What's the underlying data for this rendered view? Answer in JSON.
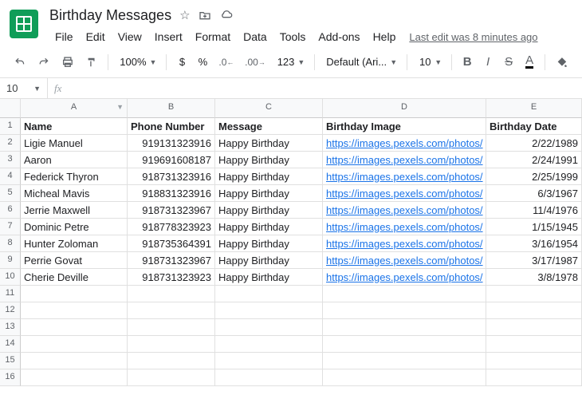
{
  "doc": {
    "title": "Birthday Messages",
    "last_edit": "Last edit was 8 minutes ago"
  },
  "menus": [
    "File",
    "Edit",
    "View",
    "Insert",
    "Format",
    "Data",
    "Tools",
    "Add-ons",
    "Help"
  ],
  "toolbar": {
    "zoom": "100%",
    "currency": "$",
    "percent": "%",
    "dec_dec": ".0",
    "dec_inc": ".00",
    "more_fmt": "123",
    "font": "Default (Ari...",
    "font_size": "10",
    "bold": "B",
    "italic": "I",
    "strike": "S",
    "textcolor": "A"
  },
  "namebox": "10",
  "fx_label": "fx",
  "columns": [
    "A",
    "B",
    "C",
    "D",
    "E"
  ],
  "headers": [
    "Name",
    "Phone Number",
    "Message",
    "Birthday Image",
    "Birthday Date"
  ],
  "rows": [
    {
      "name": "Ligie Manuel",
      "phone": "919131323916",
      "msg": "Happy Birthday",
      "img": "https://images.pexels.com/photos/",
      "date": "2/22/1989"
    },
    {
      "name": "Aaron",
      "phone": "919691608187",
      "msg": "Happy Birthday",
      "img": "https://images.pexels.com/photos/",
      "date": "2/24/1991"
    },
    {
      "name": "Federick Thyron",
      "phone": "918731323916",
      "msg": "Happy Birthday",
      "img": "https://images.pexels.com/photos/",
      "date": "2/25/1999"
    },
    {
      "name": "Micheal Mavis",
      "phone": "918831323916",
      "msg": "Happy Birthday",
      "img": "https://images.pexels.com/photos/",
      "date": "6/3/1967"
    },
    {
      "name": "Jerrie Maxwell",
      "phone": "918731323967",
      "msg": "Happy Birthday",
      "img": "https://images.pexels.com/photos/",
      "date": "11/4/1976"
    },
    {
      "name": "Dominic Petre",
      "phone": "918778323923",
      "msg": "Happy Birthday",
      "img": "https://images.pexels.com/photos/",
      "date": "1/15/1945"
    },
    {
      "name": "Hunter Zoloman",
      "phone": "918735364391",
      "msg": "Happy Birthday",
      "img": "https://images.pexels.com/photos/",
      "date": "3/16/1954"
    },
    {
      "name": "Perrie Govat",
      "phone": "918731323967",
      "msg": "Happy Birthday",
      "img": "https://images.pexels.com/photos/",
      "date": "3/17/1987"
    },
    {
      "name": "Cherie Deville",
      "phone": "918731323923",
      "msg": "Happy Birthday",
      "img": "https://images.pexels.com/photos/",
      "date": "3/8/1978"
    }
  ],
  "empty_rows": 6
}
